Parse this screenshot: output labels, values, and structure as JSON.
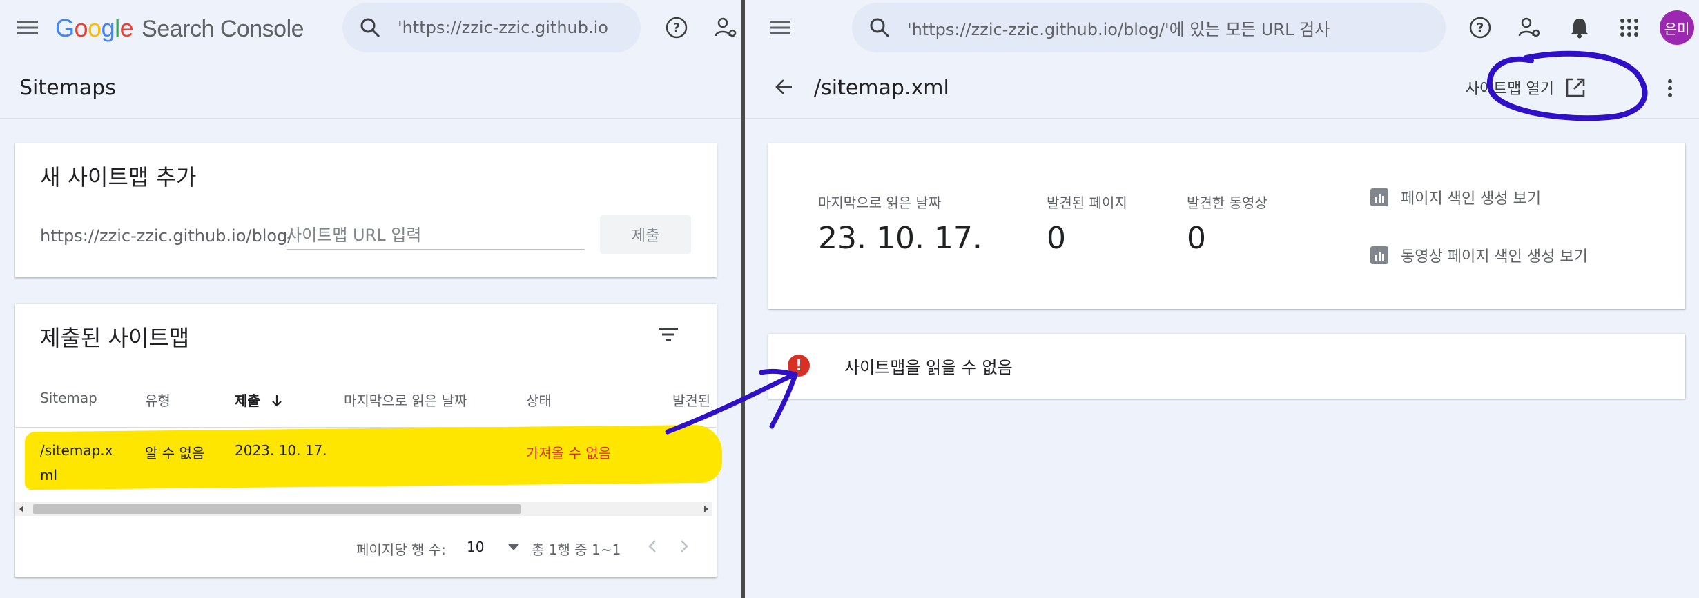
{
  "left": {
    "logo": {
      "g1": "G",
      "g2": "o",
      "g3": "o",
      "g4": "g",
      "g5": "l",
      "g6": "e",
      "product": "Search Console"
    },
    "search_text": "'https://zzic-zzic.github.io",
    "page_title": "Sitemaps",
    "add_card": {
      "title": "새 사이트맵 추가",
      "url_prefix": "https://zzic-zzic.github.io/blog/",
      "placeholder": "사이트맵 URL 입력",
      "submit_label": "제출"
    },
    "submitted_card": {
      "title": "제출된 사이트맵",
      "columns": [
        "Sitemap",
        "유형",
        "제출",
        "마지막으로 읽은 날짜",
        "상태",
        "발견된"
      ],
      "row": {
        "sitemap_line1": "/sitemap.x",
        "sitemap_line2": "ml",
        "type": "알 수 없음",
        "submitted": "2023. 10. 17.",
        "last_read": "",
        "status": "가져올 수 없음"
      },
      "pager": {
        "rows_per_page_label": "페이지당 행 수:",
        "rows_per_page_value": "10",
        "range": "총 1행 중 1~1"
      }
    }
  },
  "right": {
    "search_text": "'https://zzic-zzic.github.io/blog/'에 있는 모든 URL 검사",
    "avatar_text": "은미",
    "title": "/sitemap.xml",
    "open_sitemap_label": "사이트맵 열기",
    "stats": {
      "last_read_label": "마지막으로 읽은 날짜",
      "last_read_value": "23. 10. 17.",
      "pages_label": "발견된 페이지",
      "pages_value": "0",
      "videos_label": "발견한 동영상",
      "videos_value": "0",
      "link_page_index": "페이지 색인 생성 보기",
      "link_video_index": "동영상 페이지 색인 생성 보기"
    },
    "error_icon": "!",
    "error_text": "사이트맵을 읽을 수 없음"
  },
  "colors": {
    "highlight": "#ffe600",
    "annotation_ink": "#2f10c8",
    "error": "#d93025",
    "avatar": "#9c27b0"
  },
  "icons": [
    "menu-icon",
    "search-icon",
    "help-icon",
    "manage-users-icon",
    "back-arrow-icon",
    "open-in-new-icon",
    "more-vert-icon",
    "notifications-icon",
    "apps-icon",
    "filter-icon",
    "sort-arrow-icon",
    "chart-icon",
    "error-icon"
  ]
}
